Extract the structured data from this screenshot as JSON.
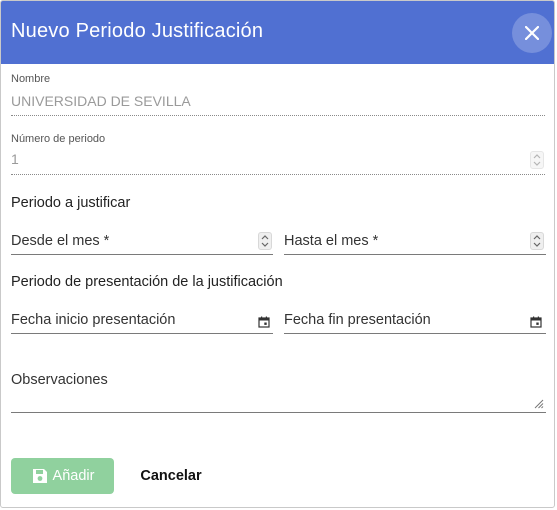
{
  "dialog": {
    "title": "Nuevo Periodo Justificación",
    "close_icon": "close-icon"
  },
  "form": {
    "nombre": {
      "label": "Nombre",
      "value": "UNIVERSIDAD DE SEVILLA"
    },
    "numero_periodo": {
      "label": "Número de periodo",
      "value": "1"
    },
    "periodo_justificar": {
      "title": "Periodo a justificar",
      "desde_placeholder": "Desde el mes *",
      "hasta_placeholder": "Hasta el mes *"
    },
    "periodo_presentacion": {
      "title": "Periodo de presentación de la justificación",
      "fecha_inicio_placeholder": "Fecha inicio presentación",
      "fecha_fin_placeholder": "Fecha fin presentación"
    },
    "observaciones": {
      "label": "Observaciones"
    }
  },
  "actions": {
    "add_label": "Añadir",
    "add_icon": "save-icon",
    "cancel_label": "Cancelar"
  },
  "colors": {
    "header": "#5070d2",
    "add_button_disabled": "#90d19e"
  }
}
